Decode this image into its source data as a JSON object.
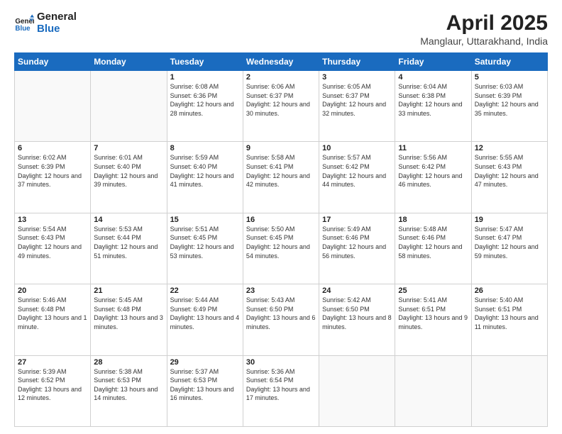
{
  "logo": {
    "line1": "General",
    "line2": "Blue"
  },
  "title": "April 2025",
  "subtitle": "Manglaur, Uttarakhand, India",
  "header": {
    "days": [
      "Sunday",
      "Monday",
      "Tuesday",
      "Wednesday",
      "Thursday",
      "Friday",
      "Saturday"
    ]
  },
  "weeks": [
    [
      {
        "day": "",
        "empty": true
      },
      {
        "day": "",
        "empty": true
      },
      {
        "day": "1",
        "sunrise": "Sunrise: 6:08 AM",
        "sunset": "Sunset: 6:36 PM",
        "daylight": "Daylight: 12 hours and 28 minutes."
      },
      {
        "day": "2",
        "sunrise": "Sunrise: 6:06 AM",
        "sunset": "Sunset: 6:37 PM",
        "daylight": "Daylight: 12 hours and 30 minutes."
      },
      {
        "day": "3",
        "sunrise": "Sunrise: 6:05 AM",
        "sunset": "Sunset: 6:37 PM",
        "daylight": "Daylight: 12 hours and 32 minutes."
      },
      {
        "day": "4",
        "sunrise": "Sunrise: 6:04 AM",
        "sunset": "Sunset: 6:38 PM",
        "daylight": "Daylight: 12 hours and 33 minutes."
      },
      {
        "day": "5",
        "sunrise": "Sunrise: 6:03 AM",
        "sunset": "Sunset: 6:39 PM",
        "daylight": "Daylight: 12 hours and 35 minutes."
      }
    ],
    [
      {
        "day": "6",
        "sunrise": "Sunrise: 6:02 AM",
        "sunset": "Sunset: 6:39 PM",
        "daylight": "Daylight: 12 hours and 37 minutes."
      },
      {
        "day": "7",
        "sunrise": "Sunrise: 6:01 AM",
        "sunset": "Sunset: 6:40 PM",
        "daylight": "Daylight: 12 hours and 39 minutes."
      },
      {
        "day": "8",
        "sunrise": "Sunrise: 5:59 AM",
        "sunset": "Sunset: 6:40 PM",
        "daylight": "Daylight: 12 hours and 41 minutes."
      },
      {
        "day": "9",
        "sunrise": "Sunrise: 5:58 AM",
        "sunset": "Sunset: 6:41 PM",
        "daylight": "Daylight: 12 hours and 42 minutes."
      },
      {
        "day": "10",
        "sunrise": "Sunrise: 5:57 AM",
        "sunset": "Sunset: 6:42 PM",
        "daylight": "Daylight: 12 hours and 44 minutes."
      },
      {
        "day": "11",
        "sunrise": "Sunrise: 5:56 AM",
        "sunset": "Sunset: 6:42 PM",
        "daylight": "Daylight: 12 hours and 46 minutes."
      },
      {
        "day": "12",
        "sunrise": "Sunrise: 5:55 AM",
        "sunset": "Sunset: 6:43 PM",
        "daylight": "Daylight: 12 hours and 47 minutes."
      }
    ],
    [
      {
        "day": "13",
        "sunrise": "Sunrise: 5:54 AM",
        "sunset": "Sunset: 6:43 PM",
        "daylight": "Daylight: 12 hours and 49 minutes."
      },
      {
        "day": "14",
        "sunrise": "Sunrise: 5:53 AM",
        "sunset": "Sunset: 6:44 PM",
        "daylight": "Daylight: 12 hours and 51 minutes."
      },
      {
        "day": "15",
        "sunrise": "Sunrise: 5:51 AM",
        "sunset": "Sunset: 6:45 PM",
        "daylight": "Daylight: 12 hours and 53 minutes."
      },
      {
        "day": "16",
        "sunrise": "Sunrise: 5:50 AM",
        "sunset": "Sunset: 6:45 PM",
        "daylight": "Daylight: 12 hours and 54 minutes."
      },
      {
        "day": "17",
        "sunrise": "Sunrise: 5:49 AM",
        "sunset": "Sunset: 6:46 PM",
        "daylight": "Daylight: 12 hours and 56 minutes."
      },
      {
        "day": "18",
        "sunrise": "Sunrise: 5:48 AM",
        "sunset": "Sunset: 6:46 PM",
        "daylight": "Daylight: 12 hours and 58 minutes."
      },
      {
        "day": "19",
        "sunrise": "Sunrise: 5:47 AM",
        "sunset": "Sunset: 6:47 PM",
        "daylight": "Daylight: 12 hours and 59 minutes."
      }
    ],
    [
      {
        "day": "20",
        "sunrise": "Sunrise: 5:46 AM",
        "sunset": "Sunset: 6:48 PM",
        "daylight": "Daylight: 13 hours and 1 minute."
      },
      {
        "day": "21",
        "sunrise": "Sunrise: 5:45 AM",
        "sunset": "Sunset: 6:48 PM",
        "daylight": "Daylight: 13 hours and 3 minutes."
      },
      {
        "day": "22",
        "sunrise": "Sunrise: 5:44 AM",
        "sunset": "Sunset: 6:49 PM",
        "daylight": "Daylight: 13 hours and 4 minutes."
      },
      {
        "day": "23",
        "sunrise": "Sunrise: 5:43 AM",
        "sunset": "Sunset: 6:50 PM",
        "daylight": "Daylight: 13 hours and 6 minutes."
      },
      {
        "day": "24",
        "sunrise": "Sunrise: 5:42 AM",
        "sunset": "Sunset: 6:50 PM",
        "daylight": "Daylight: 13 hours and 8 minutes."
      },
      {
        "day": "25",
        "sunrise": "Sunrise: 5:41 AM",
        "sunset": "Sunset: 6:51 PM",
        "daylight": "Daylight: 13 hours and 9 minutes."
      },
      {
        "day": "26",
        "sunrise": "Sunrise: 5:40 AM",
        "sunset": "Sunset: 6:51 PM",
        "daylight": "Daylight: 13 hours and 11 minutes."
      }
    ],
    [
      {
        "day": "27",
        "sunrise": "Sunrise: 5:39 AM",
        "sunset": "Sunset: 6:52 PM",
        "daylight": "Daylight: 13 hours and 12 minutes."
      },
      {
        "day": "28",
        "sunrise": "Sunrise: 5:38 AM",
        "sunset": "Sunset: 6:53 PM",
        "daylight": "Daylight: 13 hours and 14 minutes."
      },
      {
        "day": "29",
        "sunrise": "Sunrise: 5:37 AM",
        "sunset": "Sunset: 6:53 PM",
        "daylight": "Daylight: 13 hours and 16 minutes."
      },
      {
        "day": "30",
        "sunrise": "Sunrise: 5:36 AM",
        "sunset": "Sunset: 6:54 PM",
        "daylight": "Daylight: 13 hours and 17 minutes."
      },
      {
        "day": "",
        "empty": true
      },
      {
        "day": "",
        "empty": true
      },
      {
        "day": "",
        "empty": true
      }
    ]
  ]
}
